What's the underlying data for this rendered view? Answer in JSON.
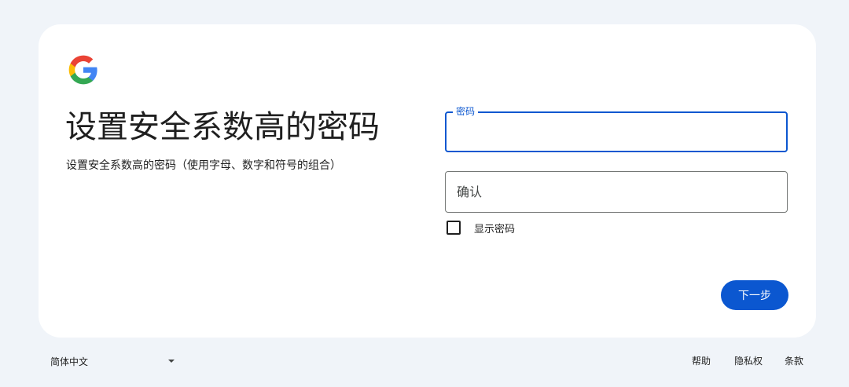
{
  "card": {
    "title": "设置安全系数高的密码",
    "subtitle": "设置安全系数高的密码（使用字母、数字和符号的组合）"
  },
  "icons": {
    "logo": "google-g-logo-icon",
    "checkbox": "checkbox-unchecked-icon",
    "caret": "caret-down-icon"
  },
  "form": {
    "password": {
      "label": "密码",
      "value": ""
    },
    "confirm": {
      "placeholder": "确认",
      "value": ""
    },
    "show_password_label": "显示密码",
    "show_password_checked": false,
    "next_label": "下一步"
  },
  "footer": {
    "language": "简体中文",
    "help": "帮助",
    "privacy": "隐私权",
    "terms": "条款"
  },
  "colors": {
    "background": "#f0f4f9",
    "card": "#ffffff",
    "accent": "#0b57d0",
    "text": "#1f1f1f",
    "border": "#747775",
    "google_blue": "#4285f4",
    "google_red": "#ea4335",
    "google_yellow": "#fbbc05",
    "google_green": "#34a853"
  }
}
